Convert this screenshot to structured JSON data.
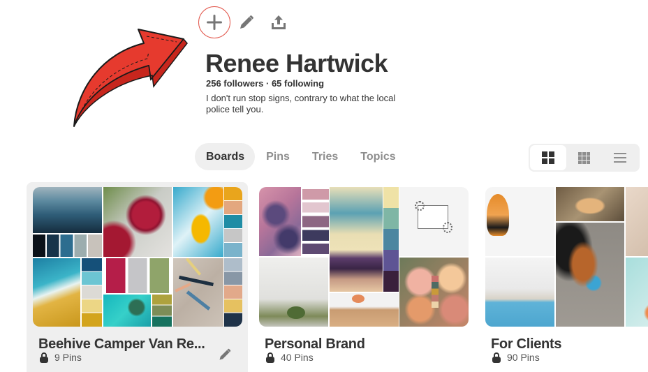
{
  "actions": {
    "add_icon": "plus-icon",
    "edit_icon": "pencil-icon",
    "share_icon": "share-upload-icon",
    "add_highlight_color": "#e2564b"
  },
  "annotation": {
    "arrow_icon": "red-arrow-annotation",
    "color": "#e63a2e"
  },
  "profile": {
    "name": "Renee Hartwick",
    "stats": "256 followers · 65 following",
    "followers": "256 followers",
    "following": "65 following",
    "bio": "I don't run stop signs, contrary to what the local police tell you."
  },
  "tabs": [
    {
      "label": "Boards",
      "active": true
    },
    {
      "label": "Pins",
      "active": false
    },
    {
      "label": "Tries",
      "active": false
    },
    {
      "label": "Topics",
      "active": false
    }
  ],
  "view_options": [
    {
      "name": "large-grid",
      "icon": "grid-large-icon",
      "active": true
    },
    {
      "name": "compact-grid",
      "icon": "grid-compact-icon",
      "active": false
    },
    {
      "name": "list",
      "icon": "list-icon",
      "active": false
    }
  ],
  "boards": [
    {
      "title": "Beehive Camper Van Re...",
      "pins": "9 Pins",
      "secret": true,
      "hovered": true
    },
    {
      "title": "Personal Brand",
      "pins": "40 Pins",
      "secret": true,
      "hovered": false
    },
    {
      "title": "For Clients",
      "pins": "90 Pins",
      "secret": true,
      "hovered": false
    }
  ],
  "colors": {
    "text": "#333333",
    "muted": "#8e8e8e",
    "tab_active_bg": "#efefef"
  }
}
